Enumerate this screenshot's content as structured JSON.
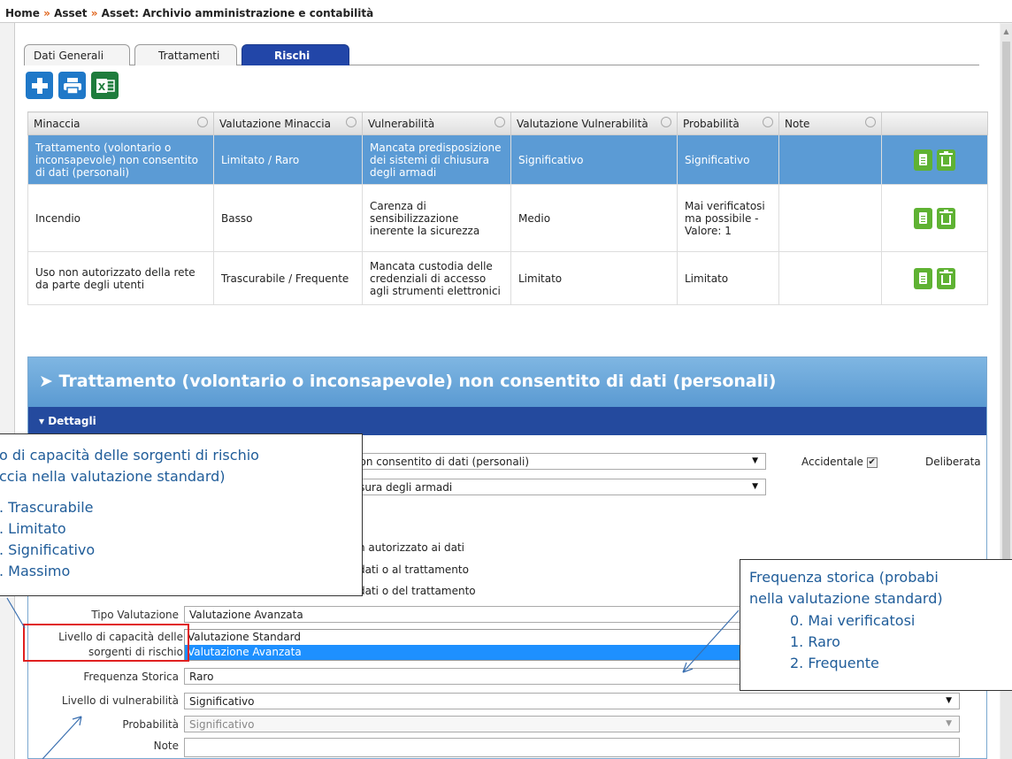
{
  "breadcrumb": {
    "home": "Home",
    "sep": "»",
    "asset": "Asset",
    "current": "Asset: Archivio amministrazione e contabilità"
  },
  "tabs": [
    {
      "label": "Dati Generali"
    },
    {
      "label": "Trattamenti"
    },
    {
      "label": "Rischi",
      "active": true
    }
  ],
  "toolbar": {
    "add": "plus-icon",
    "print": "printer-icon",
    "excel": "excel-icon",
    "excel_text": "X"
  },
  "grid": {
    "columns": [
      "Minaccia",
      "Valutazione Minaccia",
      "Vulnerabilità",
      "Valutazione Vulnerabilità",
      "Probabilità",
      "Note"
    ],
    "rows": [
      {
        "minaccia": "Trattamento (volontario o inconsapevole) non consentito di dati (personali)",
        "val_minaccia": "Limitato / Raro",
        "vulnerabilita": "Mancata predisposizione dei sistemi di chiusura degli armadi",
        "val_vulnerabilita": "Significativo",
        "probabilita": "Significativo",
        "note": ""
      },
      {
        "minaccia": "Incendio",
        "val_minaccia": "Basso",
        "vulnerabilita": "Carenza di sensibilizzazione inerente la sicurezza",
        "val_vulnerabilita": "Medio",
        "probabilita": "Mai verificatosi ma possibile - Valore: 1",
        "note": ""
      },
      {
        "minaccia": "Uso non autorizzato della rete da parte degli utenti",
        "val_minaccia": "Trascurabile / Frequente",
        "vulnerabilita": "Mancata custodia delle credenziali di accesso agli strumenti elettronici",
        "val_vulnerabilita": "Limitato",
        "probabilita": "Limitato",
        "note": ""
      }
    ]
  },
  "panel": {
    "title": "➤ Trattamento (volontario o inconsapevole) non consentito di dati (personali)",
    "section": "▾ Dettagli",
    "minaccia_value": "nsapevole) non consentito di dati (personali)",
    "vuln_value": "stemi di chiusura degli armadi",
    "accidentale": "Accidentale",
    "deliberata": "Deliberata",
    "impact1": "n autorizzato ai dati",
    "impact2": "dati o al trattamento",
    "impact3": "dati o del trattamento",
    "tipo_label": "Tipo Valutazione",
    "tipo_value": "Valutazione Avanzata",
    "liv_cap_label_1": "Livello di capacità delle",
    "liv_cap_label_2": "sorgenti di rischio",
    "dropdown_options": [
      "Valutazione Standard",
      "Valutazione Avanzata"
    ],
    "freq_label": "Frequenza Storica",
    "freq_value": "Raro",
    "liv_vuln_label": "Livello di vulnerabilità",
    "liv_vuln_value": "Significativo",
    "prob_label": "Probabilità",
    "prob_value": "Significativo",
    "note_label": "Note"
  },
  "callout_left": {
    "line1": "o di capacità delle sorgenti di rischio",
    "line2": "ccia nella valutazione standard)",
    "items": [
      ".   Trascurabile",
      ".   Limitato",
      ".   Significativo",
      ".   Massimo"
    ]
  },
  "callout_right": {
    "line1": "Frequenza storica (probabi",
    "line2": "nella valutazione standard)",
    "items": [
      "0.    Mai verificatosi",
      "1.    Raro",
      "2.    Frequente"
    ]
  }
}
